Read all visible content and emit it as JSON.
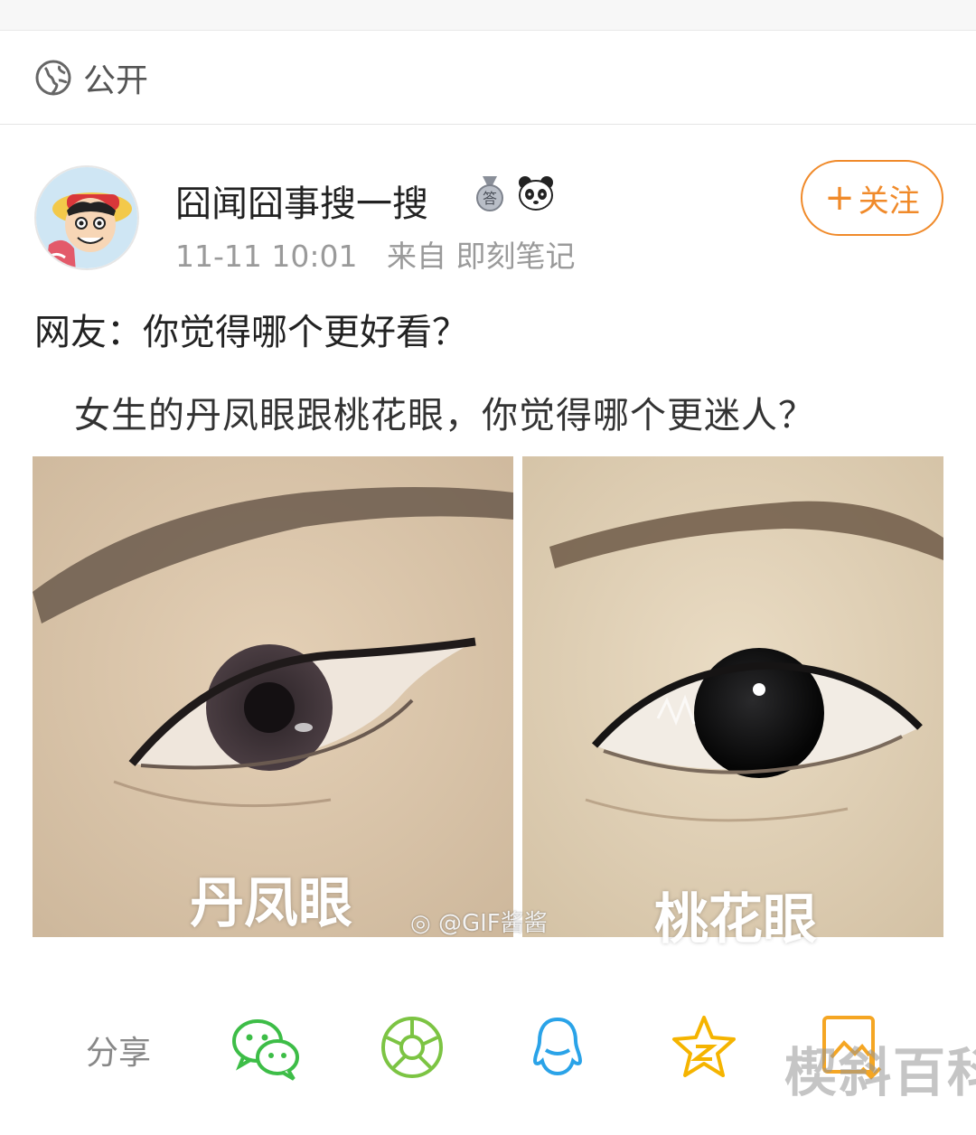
{
  "visibility": {
    "label": "公开"
  },
  "post": {
    "author": "囧闻囧事搜一搜",
    "badge_medal_text": "答",
    "time": "11-11 10:01",
    "source": "来自 即刻笔记",
    "follow_label": "关注",
    "text": "网友：你觉得哪个更好看？",
    "image": {
      "caption": "女生的丹凤眼跟桃花眼，你觉得哪个更迷人？",
      "left_label": "丹凤眼",
      "right_label": "桃花眼",
      "watermark": "@GIF酱酱"
    }
  },
  "share": {
    "label": "分享"
  },
  "site_mark": "楔斜百科",
  "colors": {
    "accent": "#f08a2a",
    "wechat": "#3dbd47",
    "moments": "#7cc443",
    "qq": "#2aa3e8",
    "qzone": "#f5b400"
  }
}
